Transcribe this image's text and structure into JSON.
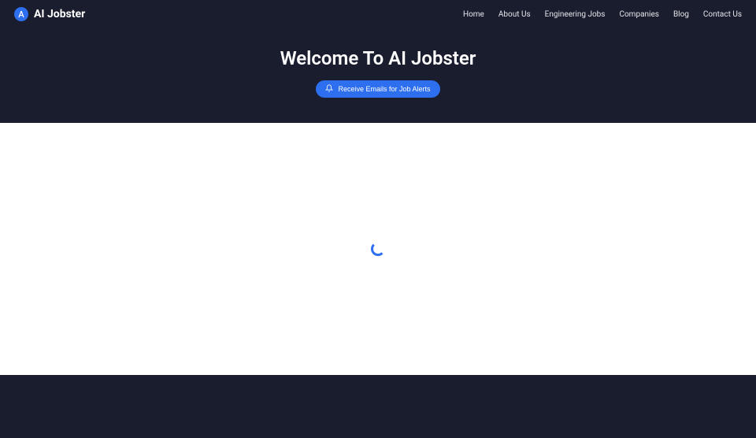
{
  "brand": {
    "name": "AI Jobster"
  },
  "nav": {
    "items": [
      {
        "label": "Home"
      },
      {
        "label": "About Us"
      },
      {
        "label": "Engineering Jobs"
      },
      {
        "label": "Companies"
      },
      {
        "label": "Blog"
      },
      {
        "label": "Contact Us"
      }
    ]
  },
  "hero": {
    "title": "Welcome To AI Jobster",
    "alert_button_label": "Receive Emails for Job Alerts"
  },
  "colors": {
    "header_bg": "#1a1d2e",
    "accent": "#2e6fef",
    "text_light": "#ffffff"
  }
}
